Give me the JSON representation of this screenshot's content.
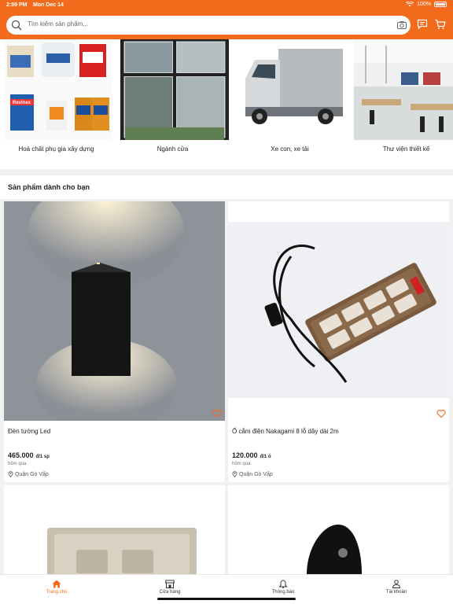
{
  "status_bar": {
    "time": "2:59 PM",
    "date": "Mon Dec 14",
    "battery": "100%"
  },
  "colors": {
    "accent": "#f26b1d",
    "background": "#f1f1f1"
  },
  "search": {
    "placeholder": "Tìm kiếm sản phẩm...",
    "icons": [
      "search-icon",
      "camera-icon",
      "chat-icon",
      "cart-icon"
    ]
  },
  "categories": [
    {
      "label": "Hoá chất phụ gia xây dựng",
      "image": "Revinex"
    },
    {
      "label": "Ngành cửa"
    },
    {
      "label": "Xe con, xe tải"
    },
    {
      "label": "Thư viện thiết kế"
    }
  ],
  "section": {
    "title": "Sản phẩm dành cho bạn"
  },
  "products": [
    {
      "name": "Đèn tường Led",
      "price": "465.000",
      "unit": "đ/1 sp",
      "time": "hôm qua",
      "location": "Quận Gò Vấp"
    },
    {
      "name": "Ổ cắm điện Nakagami 8 lỗ dây dài 2m",
      "price": "120.000",
      "unit": "đ/1 ổ",
      "time": "hôm qua",
      "location": "Quận Gò Vấp"
    }
  ],
  "tabbar": [
    {
      "label": "Trang chủ",
      "icon": "home-icon",
      "active": true
    },
    {
      "label": "Cửa hàng",
      "icon": "store-icon",
      "active": false
    },
    {
      "label": "Thông báo",
      "icon": "bell-icon",
      "active": false
    },
    {
      "label": "Tài khoản",
      "icon": "user-icon",
      "active": false
    }
  ]
}
